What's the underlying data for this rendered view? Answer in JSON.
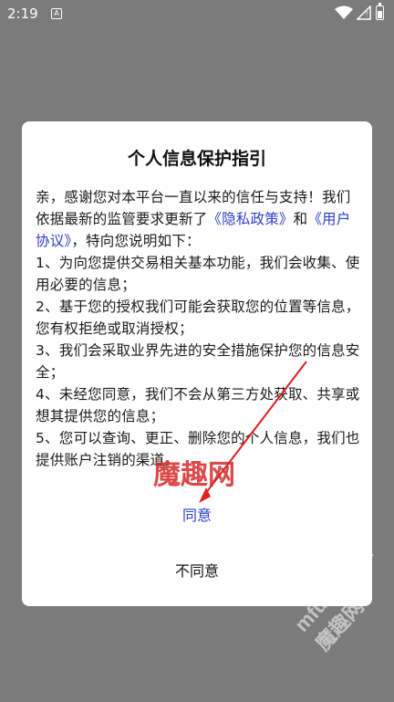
{
  "status_bar": {
    "time": "2:19",
    "notification_icon": "A"
  },
  "dialog": {
    "title": "个人信息保护指引",
    "intro_prefix": "亲，感谢您对本平台一直以来的信任与支持！我们依据最新的监管要求更新了",
    "privacy_link": "《隐私政策》",
    "and_text": "和",
    "agreement_link": "《用户协议》",
    "intro_suffix": "，特向您说明如下：",
    "items": [
      "1、为向您提供交易相关基本功能，我们会收集、使用必要的信息；",
      "2、基于您的授权我们可能会获取您的位置等信息，您有权拒绝或取消授权；",
      "3、我们会采取业界先进的安全措施保护您的信息安全；",
      "4、未经您同意，我们不会从第三方处获取、共享或想其提供您的信息；",
      "5、您可以查询、更正、删除您的个人信息，我们也提供账户注销的渠道。"
    ],
    "agree_label": "同意",
    "disagree_label": "不同意"
  },
  "watermarks": {
    "center": "魔趣网",
    "corner": "mfunz.com 魔趣网"
  },
  "colors": {
    "link": "#2a3ec9",
    "overlay": "#7b7b7b",
    "arrow": "#e02020"
  }
}
